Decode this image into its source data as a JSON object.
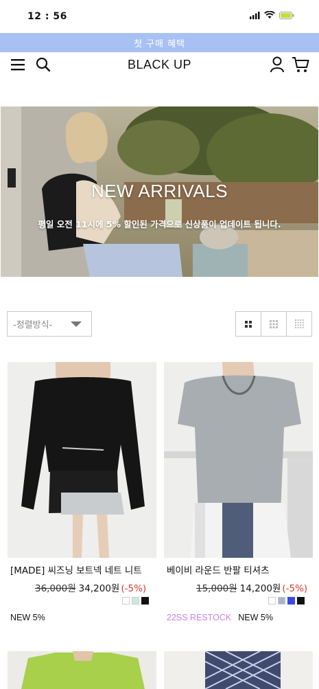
{
  "status": {
    "time": "12 : 56"
  },
  "promo": {
    "text": "첫 구매 혜택"
  },
  "header": {
    "logo": "BLACK UP"
  },
  "hero": {
    "title": "NEW ARRIVALS",
    "subtitle": "평일 오전 11시에  5% 할인된 가격으로 신상품이 업데이트 됩니다."
  },
  "sort": {
    "label": "-정렬방식-"
  },
  "colors": {
    "accent": "#a8c1f4",
    "discount": "#e0362c",
    "restock": "#d07ee8"
  },
  "products": [
    {
      "name": "[MADE] 씨즈닝 보트넥 네트 니트",
      "price_old": "36,000원",
      "price_new": "34,200원",
      "discount": "(-5%)",
      "swatches": [
        "#ffffff",
        "#cfe9dc",
        "#111111"
      ],
      "badges": [
        "NEW 5%"
      ]
    },
    {
      "name": "베이비 라운드 반팔 티셔츠",
      "price_old": "15,000원",
      "price_new": "14,200원",
      "discount": "(-5%)",
      "swatches": [
        "#ffffff",
        "#a9b3d4",
        "#3a49e6",
        "#111111"
      ],
      "badges": [
        "22SS RESTOCK",
        "NEW 5%"
      ]
    }
  ]
}
